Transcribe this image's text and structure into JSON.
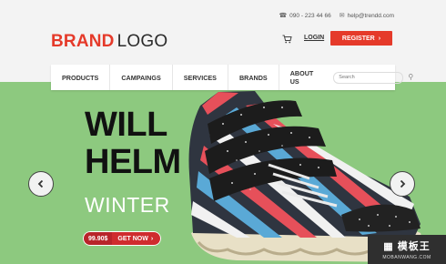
{
  "header": {
    "phone": "090 - 223 44 66",
    "email": "help@trendd.com",
    "logo_brand": "BRAND",
    "logo_word": "LOGO",
    "login_label": "LOGIN",
    "register_label": "REGISTER"
  },
  "nav": {
    "items": [
      {
        "label": "PRODUCTS"
      },
      {
        "label": "CAMPAINGS"
      },
      {
        "label": "SERVICES"
      },
      {
        "label": "BRANDS"
      },
      {
        "label": "ABOUT US"
      }
    ],
    "search_placeholder": "Search"
  },
  "hero": {
    "line1": "WILL",
    "line2": "HELM",
    "subtitle": "WINTER",
    "price": "99.90$",
    "cta_label": "GET NOW"
  },
  "watermark": {
    "title": "模板王",
    "url": "MOBANWANG.COM"
  },
  "icons": {
    "phone": "phone-icon",
    "email": "mail-icon",
    "cart": "cart-icon",
    "search": "search-icon",
    "arrow_left": "chevron-left-icon",
    "arrow_right": "chevron-right-icon"
  },
  "colors": {
    "accent": "#e53a2a",
    "hero_bg": "#8dc97f",
    "cta_bg": "#cf2c2e"
  }
}
